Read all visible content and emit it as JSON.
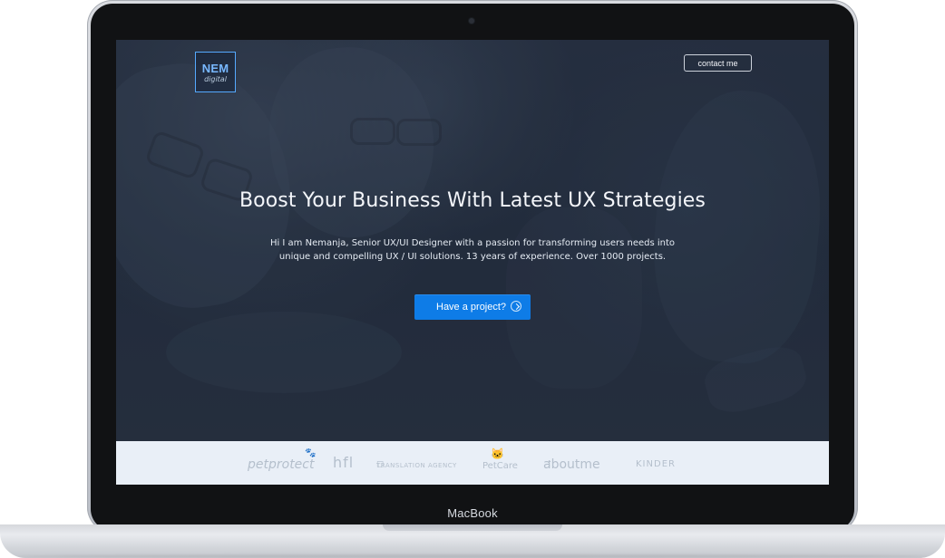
{
  "device": {
    "brand": "MacBook"
  },
  "site": {
    "logo": {
      "main": "NEM",
      "sub": "digital"
    },
    "header": {
      "contact_label": "contact me"
    },
    "hero": {
      "title": "Boost Your Business With Latest UX Strategies",
      "description": "Hi I am Nemanja, Senior UX/UI Designer with a passion for transforming users needs into unique and compelling UX / UI solutions. 13 years of experience. Over 1000 projects.",
      "cta_label": "Have a project?"
    },
    "logos": [
      "petprotect",
      "hfl",
      "TRANSLATION AGENCY",
      "PetCare",
      "aboutme",
      "KINDER"
    ]
  },
  "colors": {
    "accent": "#0e7ce7",
    "logo_blue": "#78b8ff"
  },
  "icons": {
    "camera": "camera-icon",
    "cta": "chevron-right-circle-icon"
  }
}
